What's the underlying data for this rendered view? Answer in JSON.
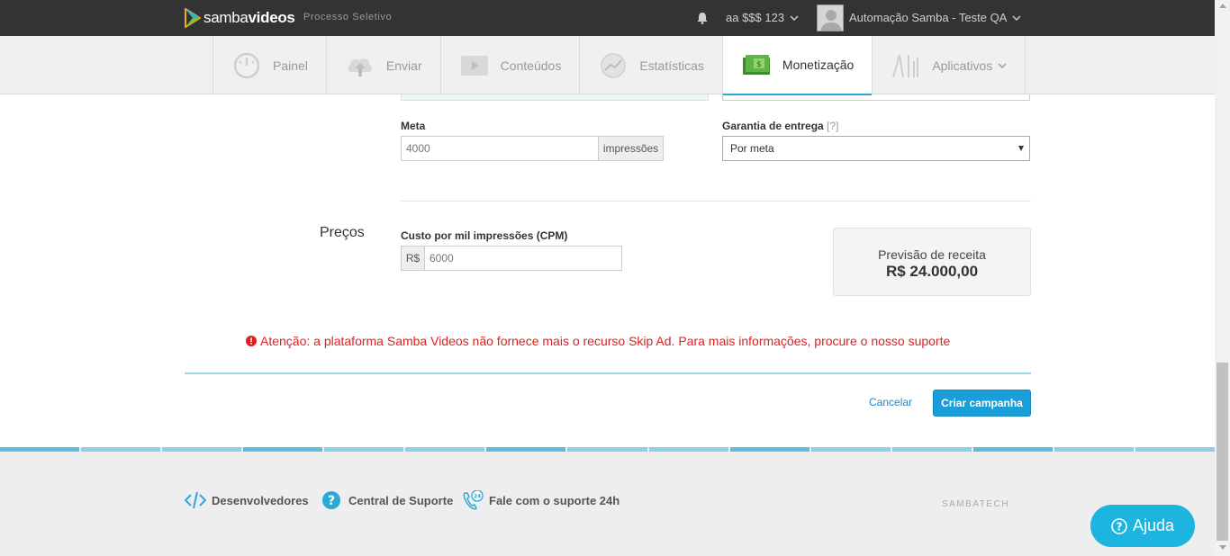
{
  "header": {
    "logo_light": "samba",
    "logo_bold": "videos",
    "subtitle": "Processo Seletivo",
    "account": "aa $$$ 123",
    "user": "Automação Samba - Teste QA"
  },
  "nav": {
    "items": [
      {
        "label": "Painel",
        "icon": "gauge-icon"
      },
      {
        "label": "Enviar",
        "icon": "cloud-upload-icon"
      },
      {
        "label": "Conteúdos",
        "icon": "film-folder-icon"
      },
      {
        "label": "Estatísticas",
        "icon": "chart-circle-icon"
      },
      {
        "label": "Monetização",
        "icon": "money-icon",
        "active": true
      },
      {
        "label": "Aplicativos",
        "icon": "apps-icon"
      }
    ]
  },
  "form": {
    "meta_label": "Meta",
    "meta_value": "4000",
    "meta_addon": "impressões",
    "garantia_label": "Garantia de entrega",
    "garantia_hint": "[?]",
    "garantia_value": "Por meta",
    "section_precos": "Preços",
    "cpm_label": "Custo por mil impressões (CPM)",
    "cpm_prefix": "R$",
    "cpm_value": "6000",
    "revenue_label": "Previsão de receita",
    "revenue_value": "R$ 24.000,00",
    "warning": "Atenção: a plataforma Samba Videos não fornece mais o recurso Skip Ad. Para mais informações, procure o nosso suporte",
    "cancel_label": "Cancelar",
    "create_label": "Criar campanha"
  },
  "footer": {
    "dev": "Desenvolvedores",
    "support": "Central de Suporte",
    "support24": "Fale com o suporte 24h",
    "brand": "SAMBATECH",
    "help": "Ajuda"
  },
  "colors": {
    "accent": "#1a9ed9",
    "warning": "#e02020",
    "topbar": "#333333"
  }
}
